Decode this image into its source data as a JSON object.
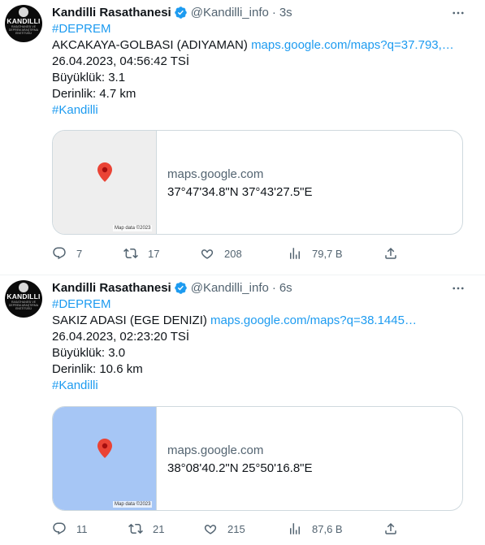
{
  "tweets": [
    {
      "author_name": "Kandilli Rasathanesi",
      "handle": "@Kandilli_info",
      "separator": "·",
      "time": "3s",
      "hashtag1": "#DEPREM",
      "location": "AKCAKAYA-GOLBASI (ADIYAMAN)",
      "maps_link": "maps.google.com/maps?q=37.793,…",
      "datetime": "26.04.2023, 04:56:42 TSİ",
      "magnitude": "Büyüklük: 3.1",
      "depth": "Derinlik: 4.7 km",
      "hashtag2": "#Kandilli",
      "card_domain": "maps.google.com",
      "card_coords": "37°47'34.8\"N 37°43'27.5\"E",
      "map_attribution": "Map data ©2023",
      "replies": "7",
      "retweets": "17",
      "likes": "208",
      "views": "79,7 B"
    },
    {
      "author_name": "Kandilli Rasathanesi",
      "handle": "@Kandilli_info",
      "separator": "·",
      "time": "6s",
      "hashtag1": "#DEPREM",
      "location": "SAKIZ ADASI (EGE DENIZI)",
      "maps_link": "maps.google.com/maps?q=38.1445…",
      "datetime": "26.04.2023, 02:23:20 TSİ",
      "magnitude": "Büyüklük: 3.0",
      "depth": "Derinlik: 10.6 km",
      "hashtag2": "#Kandilli",
      "card_domain": "maps.google.com",
      "card_coords": "38°08'40.2\"N 25°50'16.8\"E",
      "map_attribution": "Map data ©2023",
      "replies": "11",
      "retweets": "21",
      "likes": "215",
      "views": "87,6 B"
    }
  ],
  "avatar_text": "KANDILLI",
  "avatar_subtext": "RASATHANESI VE DEPREM ARAŞTIRMA ENSTİTÜSÜ",
  "colors": {
    "link": "#1d9bf0",
    "secondary": "#536471",
    "border": "#cfd9de",
    "verified": "#1d9bf0",
    "map_land": "#eeeeee",
    "map_sea": "#a6c6f5",
    "pin": "#ea4335"
  }
}
